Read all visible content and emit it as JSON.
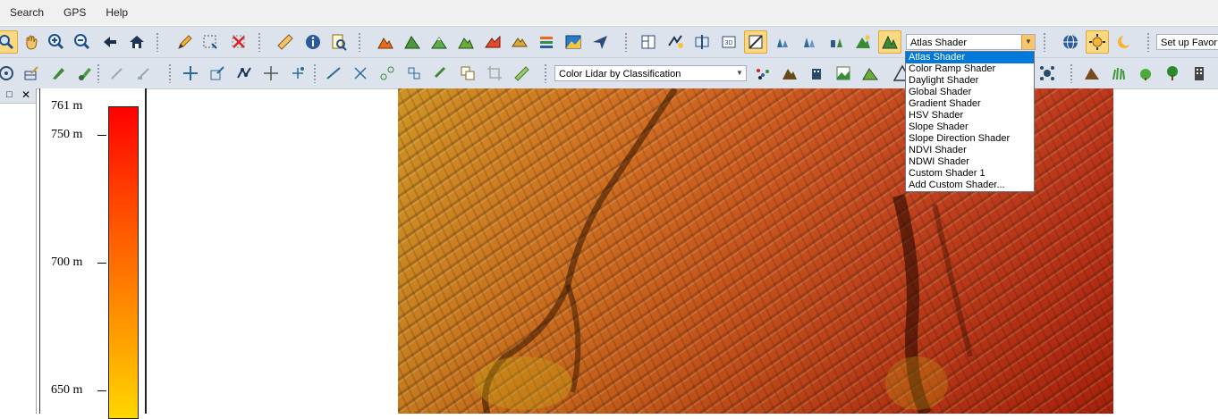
{
  "menu": {
    "items": [
      "Search",
      "GPS",
      "Help"
    ]
  },
  "toolbar": {
    "shader_combo": "Atlas Shader",
    "favorites_combo": "Set up Favor",
    "lidar_combo": "Color Lidar by Classification"
  },
  "shader_dropdown": {
    "items": [
      "Atlas Shader",
      "Color Ramp Shader",
      "Daylight Shader",
      "Global Shader",
      "Gradient Shader",
      "HSV Shader",
      "Slope Shader",
      "Slope Direction Shader",
      "NDVI Shader",
      "NDWI Shader",
      "Custom Shader 1",
      "Add Custom Shader..."
    ],
    "selected_index": 0
  },
  "legend": {
    "labels": [
      "761 m",
      "750 m",
      "700 m",
      "650 m"
    ],
    "colors": {
      "top": "#ff0000",
      "bottom": "#ffd700"
    }
  },
  "colors": {
    "toolbar_bg": "#dde3ec",
    "active_button": "#fbd983",
    "selection": "#0078d7"
  },
  "icons": {
    "row1": [
      "zoom-box-icon",
      "pan-hand-icon",
      "zoom-in-icon",
      "zoom-out-icon",
      "back-arrow-icon",
      "home-icon",
      "pencil-icon",
      "select-box-icon",
      "delete-x-icon",
      "ruler-icon",
      "info-icon",
      "search-doc-icon",
      "terrain-icon",
      "terrain-icon",
      "terrain-icon",
      "terrain-icon",
      "terrain-icon",
      "terrain-icon",
      "image-icon",
      "plane-icon",
      "layout-icon",
      "route-icon",
      "profile-icon",
      "3d-view-icon",
      "shader-toggle-icon",
      "lidar-icon",
      "lidar-icon",
      "lidar-icon",
      "tree-icon",
      "shader-active-icon",
      "globe-icon",
      "sun-icon",
      "moon-icon"
    ],
    "row2": [
      "target-icon",
      "grid-edit-icon",
      "pen-icon",
      "brush-icon",
      "line-edit-icon",
      "cursor-edit-icon",
      "move-vertices-icon",
      "scale-icon",
      "node-icon",
      "move-icon",
      "add-point-icon",
      "line-icon",
      "cut-icon",
      "link-icon",
      "bridge-icon",
      "rotate-icon",
      "copy-icon",
      "crop-icon",
      "ruler-icon",
      "lidar-class-icon",
      "mountain-icon",
      "building-icon",
      "image-icon",
      "terrain-icon",
      "alert-icon",
      "network-icon",
      "mountain-icon",
      "grass-icon",
      "shrub-icon",
      "tree-icon",
      "building-icon"
    ]
  }
}
